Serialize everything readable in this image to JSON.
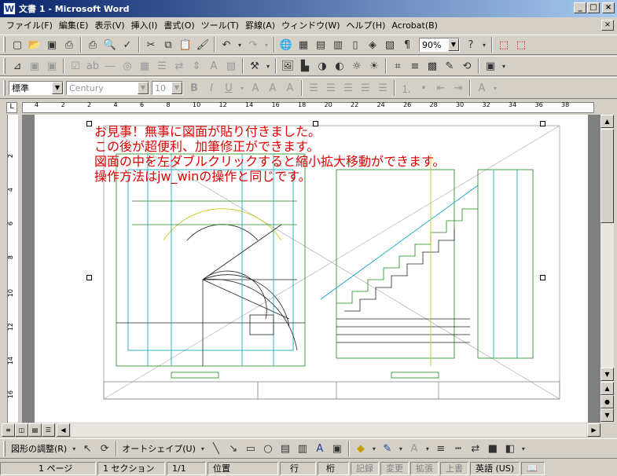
{
  "window": {
    "title": "文書 1 - Microsoft Word",
    "app_icon": "W"
  },
  "menu": [
    "ファイル(F)",
    "編集(E)",
    "表示(V)",
    "挿入(I)",
    "書式(O)",
    "ツール(T)",
    "罫線(A)",
    "ウィンドウ(W)",
    "ヘルプ(H)",
    "Acrobat(B)"
  ],
  "standard_toolbar": {
    "zoom": "90%",
    "help": "?"
  },
  "formatting_toolbar": {
    "style": "標準",
    "font": "Century",
    "size": "10"
  },
  "ruler": {
    "ticks": [
      "4",
      "2",
      "2",
      "4",
      "6",
      "8",
      "10",
      "12",
      "14",
      "16",
      "18",
      "20",
      "22",
      "24",
      "26",
      "28",
      "30",
      "32",
      "34",
      "36",
      "38"
    ]
  },
  "vruler": {
    "ticks": [
      "2",
      "4",
      "6",
      "8",
      "10",
      "12",
      "14",
      "16"
    ]
  },
  "document": {
    "lines": [
      "お見事！無事に図面が貼り付きました。",
      "この後が超便利、加筆修正ができます。",
      "図面の中を左ダブルクリックすると縮小拡大移動ができます。",
      "操作方法はjw_winの操作と同じです。"
    ]
  },
  "drawing_toolbar": {
    "adjust": "図形の調整(R)",
    "autoshape": "オートシェイプ(U)"
  },
  "status": {
    "page": "1 ページ",
    "section": "1 セクション",
    "pages": "1/1",
    "position": "位置",
    "line": "行",
    "column": "桁",
    "rec": "記録",
    "trk": "変更",
    "ext": "拡張",
    "ovr": "上書",
    "lang": "英語 (US)"
  },
  "colors": {
    "title_start": "#0a246a",
    "title_end": "#a6caf0",
    "red_text": "#e00000",
    "cad_green": "#1a8a1a",
    "cad_cyan": "#00a0c0",
    "cad_yellow": "#c8c000"
  }
}
